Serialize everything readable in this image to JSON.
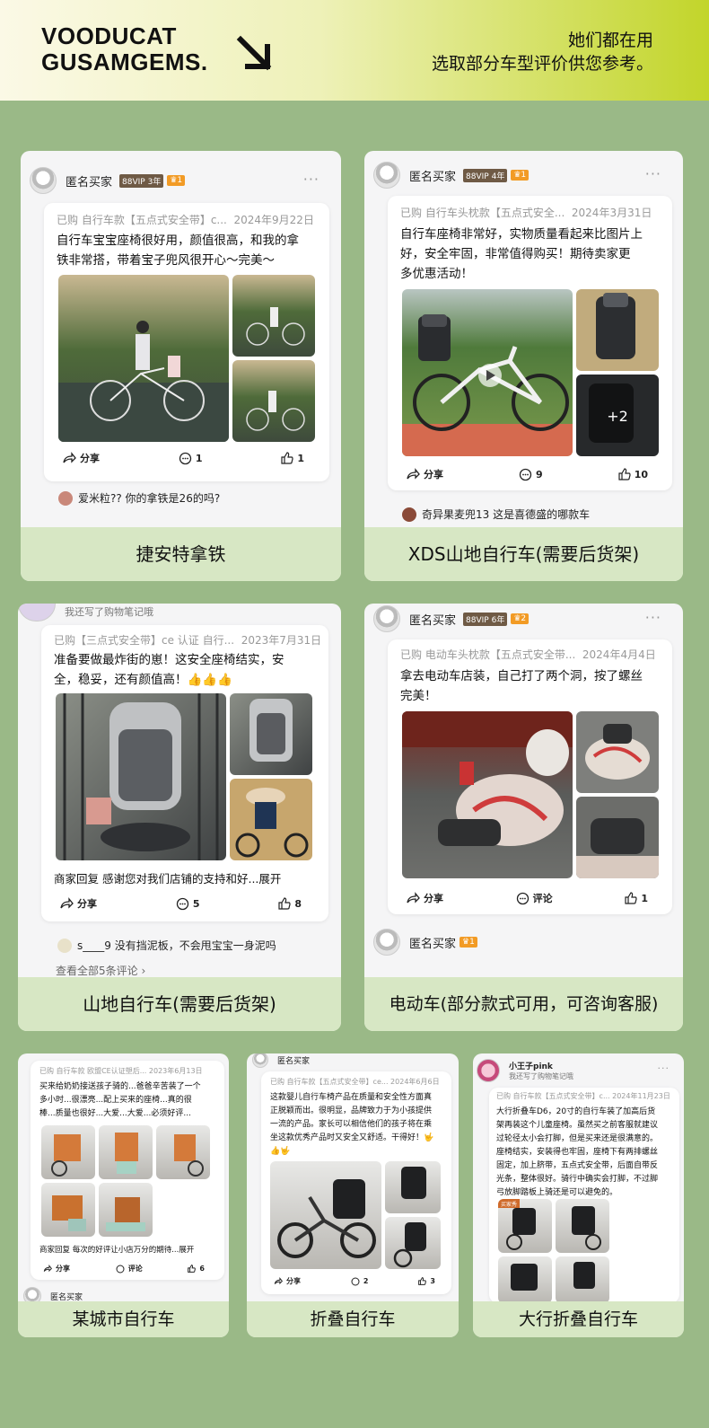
{
  "header": {
    "brand_line1": "VOODUCAT",
    "brand_line2": "GUSAMGEMS.",
    "slogan_line1": "她们都在用",
    "slogan_line2": "选取部分车型评价供您参考。"
  },
  "colors": {
    "page_bg": "#9ab987",
    "caption_bg": "#d7e7c4",
    "accent_yellow": "#c2d52a"
  },
  "icons": [
    "arrow-down-right-icon",
    "share-icon",
    "comment-icon",
    "thumb-up-icon",
    "more-icon"
  ],
  "cards": [
    {
      "username": "匿名买家",
      "vip": "88VIP",
      "vip_years": "3年",
      "level": "1",
      "meta": "已购 自行车款【五点式安全带】c...",
      "date": "2024年9月22日",
      "review_l1": "自行车宝宝座椅很好用，颜值很高，和我的拿",
      "review_l2": "铁非常搭，带着宝子兜风很开心～完美～",
      "share": "分享",
      "comments": "1",
      "likes": "1",
      "comment": "爱米粒?? 你的拿铁是26的吗?",
      "caption": "捷安特拿铁"
    },
    {
      "username": "匿名买家",
      "vip": "88VIP",
      "vip_years": "4年",
      "level": "1",
      "meta": "已购 自行车头枕款【五点式安全...",
      "date": "2024年3月31日",
      "review_l1": "自行车座椅非常好，实物质量看起来比图片上",
      "review_l2": "好，安全牢固，非常值得购买！期待卖家更",
      "review_l3": "多优惠活动！",
      "plus": "+2",
      "share": "分享",
      "comments": "9",
      "likes": "10",
      "comment": "奇异果麦兜13 这是喜德盛的哪款车",
      "caption": "XDS山地自行车(需要后货架)"
    },
    {
      "top_note": "我还写了购物笔记哦",
      "meta": "已购【三点式安全带】ce 认证 自行...",
      "date": "2023年7月31日",
      "review_l1": "准备要做最炸街的崽！这安全座椅结实，安",
      "review_l2": "全，稳妥，还有颜值高！👍👍👍",
      "merchant": "商家回复 感谢您对我们店铺的支持和好...展开",
      "share": "分享",
      "comments": "5",
      "likes": "8",
      "comment": "s____9 没有挡泥板，不会甩宝宝一身泥吗",
      "view_all": "查看全部5条评论 ›",
      "caption": "山地自行车(需要后货架)"
    },
    {
      "username": "匿名买家",
      "vip": "88VIP",
      "vip_years": "6年",
      "level": "2",
      "meta": "已购 电动车头枕款【五点式安全带...",
      "date": "2024年4月4日",
      "review_l1": "拿去电动车店装，自己打了两个洞，按了螺丝",
      "review_l2": "完美！",
      "share": "分享",
      "comments_label": "评论",
      "likes": "1",
      "username2": "匿名买家",
      "level2": "1",
      "caption": "电动车(部分款式可用，可咨询客服)"
    },
    {
      "meta": "已购 自行车款 欧盟CE认证塑后...",
      "date": "2023年6月13日",
      "review_l1": "买来给奶奶接送孩子骑的...爸爸辛苦装了一个",
      "review_l2": "多小时...很漂亮...配上买来的座椅...真的很",
      "review_l3": "棒...质量也很好...大爱...大爱...必须好评...",
      "merchant": "商家回复 每次的好评让小店万分的期待...展开",
      "share": "分享",
      "comments_label": "评论",
      "likes": "6",
      "username2": "匿名买家",
      "caption": "某城市自行车"
    },
    {
      "username": "匿名买家",
      "meta": "已购 自行车款【五点式安全带】ce...",
      "date": "2024年6月6日",
      "review_l1": "这款婴儿自行车椅产品在质量和安全性方面真",
      "review_l2": "正脱颖而出。很明显，品牌致力于为小孩提供",
      "review_l3": "一流的产品。家长可以相信他们的孩子将在乘",
      "review_l4": "坐这款优秀产品时又安全又舒适。干得好！🤟",
      "review_l5": "👍🤟",
      "share": "分享",
      "comments": "2",
      "likes": "3",
      "caption": "折叠自行车"
    },
    {
      "username": "小王子pink",
      "top_note": "我还写了购物笔记哦",
      "meta": "已购 自行车款【五点式安全带】c...",
      "date": "2024年11月23日",
      "review_l1": "大行折叠车D6，20寸的自行车装了加高后货",
      "review_l2": "架再装这个儿童座椅。虽然买之前客服就建议",
      "review_l3": "过轮径太小会打脚，但是买来还是很满意的。",
      "review_l4": "座椅结实，安装得也牢固，座椅下有两排螺丝",
      "review_l5": "固定，加上脐带，五点式安全带，后面自带反",
      "review_l6": "光条，整体很好。骑行中确实会打脚，不过脚",
      "review_l7": "弓放脚踏板上骑还是可以避免的。",
      "buyer_show": "买家秀",
      "caption": "大行折叠自行车"
    }
  ]
}
